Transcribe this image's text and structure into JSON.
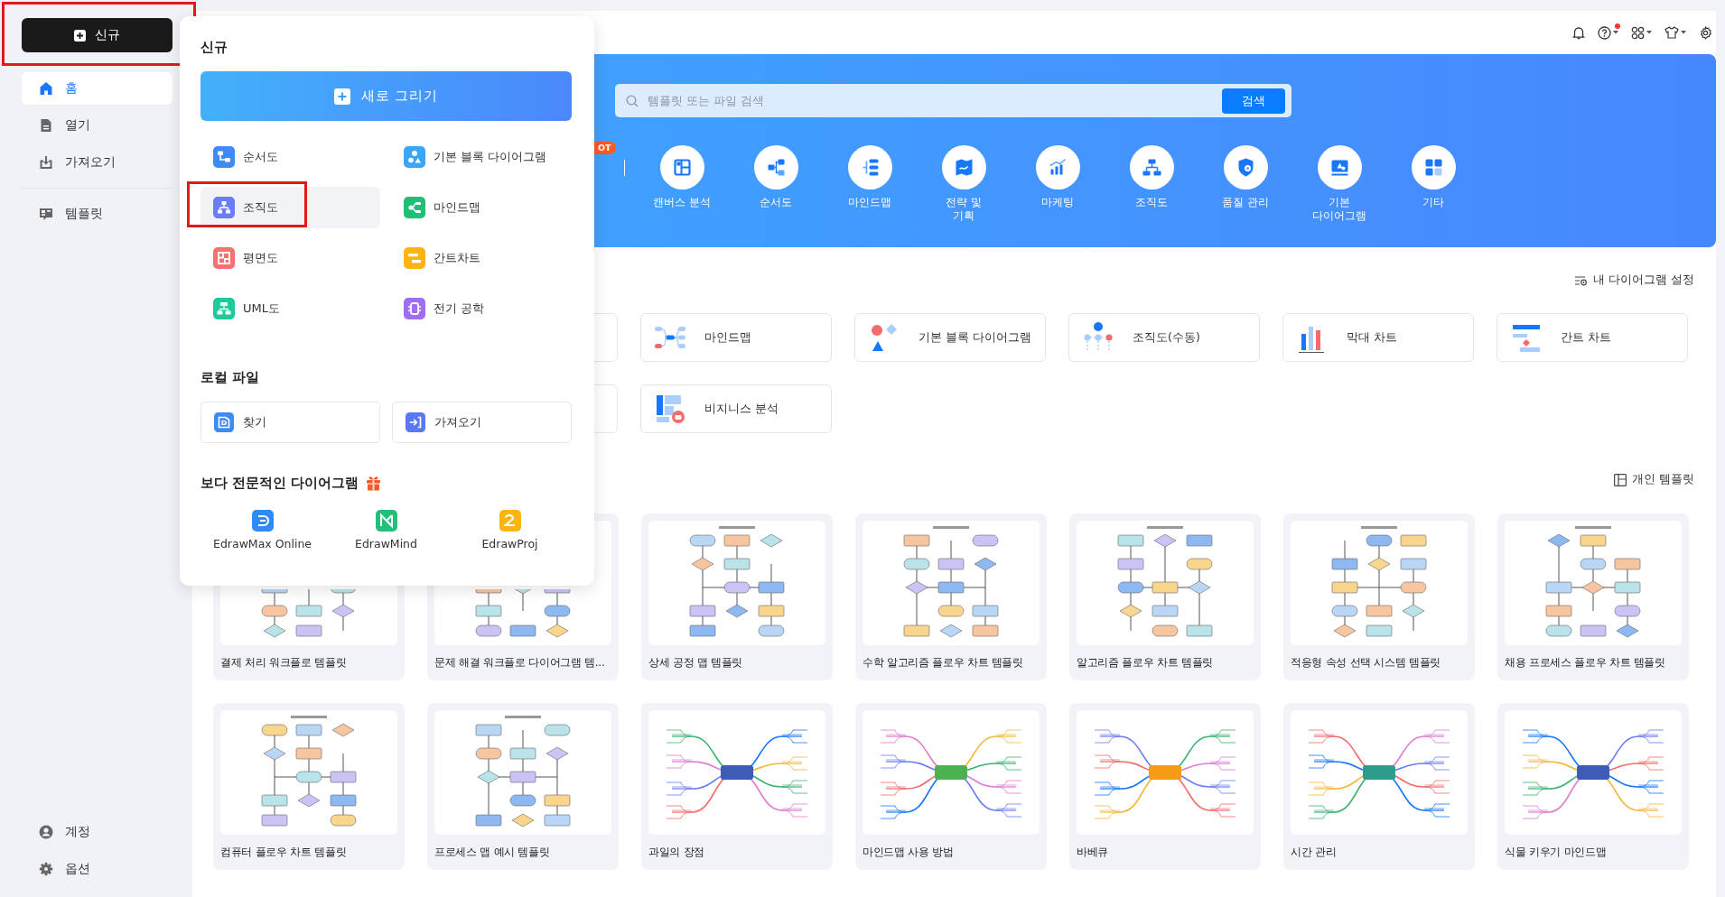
{
  "new_button": {
    "label": "신규",
    "outlined": true
  },
  "sidebar": {
    "main_items": [
      {
        "label": "홈",
        "selected": true
      },
      {
        "label": "열기",
        "selected": false
      },
      {
        "label": "가져오기",
        "selected": false
      }
    ],
    "template_items": [
      {
        "label": "템플릿",
        "selected": false
      }
    ],
    "bottom_items": [
      {
        "label": "계정"
      },
      {
        "label": "옵션"
      }
    ]
  },
  "new_menu": {
    "title": "신규",
    "draw_button": "새로 그리기",
    "diagram_types": [
      {
        "label": "순서도",
        "color": "#3d8bf7",
        "highlighted": false,
        "outlined": false
      },
      {
        "label": "기본 블록 다이어그램",
        "color": "#3aa6f5",
        "highlighted": false,
        "outlined": false
      },
      {
        "label": "조직도",
        "color": "#6a7cf7",
        "highlighted": true,
        "outlined": true
      },
      {
        "label": "마인드맵",
        "color": "#1fbf75",
        "highlighted": false,
        "outlined": false
      },
      {
        "label": "평면도",
        "color": "#f7706e",
        "highlighted": false,
        "outlined": false
      },
      {
        "label": "간트차트",
        "color": "#fbb414",
        "highlighted": false,
        "outlined": false
      },
      {
        "label": "UML도",
        "color": "#1ec99a",
        "highlighted": false,
        "outlined": false
      },
      {
        "label": "전기 공학",
        "color": "#a06ef2",
        "highlighted": false,
        "outlined": false
      }
    ],
    "local_title": "로컬 파일",
    "local_buttons": [
      {
        "label": "찾기",
        "color": "#3d8bf7"
      },
      {
        "label": "가져오기",
        "color": "#5b78f6"
      }
    ],
    "pro_title": "보다 전문적인 다이어그램",
    "apps": [
      {
        "label": "EdrawMax Online",
        "color": "#2d8cf5"
      },
      {
        "label": "EdrawMind",
        "color": "#22c07a"
      },
      {
        "label": "EdrawProj",
        "color": "#fbb414"
      }
    ]
  },
  "top_bar": {
    "help_badge": true
  },
  "banner": {
    "search": {
      "placeholder": "템플릿 또는 파일 검색",
      "button": "검색"
    },
    "hot_badge": "OT",
    "categories": [
      "캔버스 분석",
      "순서도",
      "마인드맵",
      "전략 및\n기획",
      "마케팅",
      "조직도",
      "품질 관리",
      "기본\n다이어그램",
      "기타"
    ]
  },
  "diagram_settings": "내 다이어그램 설정",
  "shortcut_rows": [
    [
      "마인드맵",
      "기본 블록 다이어그램",
      "조직도(수동)",
      "막대 차트",
      "간트 차트"
    ],
    [
      "비지니스 분석"
    ]
  ],
  "personal_templates": "개인 템플릿",
  "templates": [
    {
      "title": "결제 처리 워크플로 템플릿",
      "kind": "flowchart"
    },
    {
      "title": "문제 해결 워크플로 다이어그램 템...",
      "kind": "flowchart"
    },
    {
      "title": "상세 공정 맵 템플릿",
      "kind": "flowchart"
    },
    {
      "title": "수학 알고리즘 플로우 차트 템플릿",
      "kind": "flowchart"
    },
    {
      "title": "알고리즘 플로우 차트 템플릿",
      "kind": "flowchart"
    },
    {
      "title": "적응형 속성 선택 시스템 템플릿",
      "kind": "flowchart"
    },
    {
      "title": "채용 프로세스 플로우 차트 템플릿",
      "kind": "flowchart"
    },
    {
      "title": "컴퓨터 플로우 차트 템플릿",
      "kind": "flowchart"
    },
    {
      "title": "프로세스 맵 예시 템플릿",
      "kind": "flowchart"
    },
    {
      "title": "과일의 장점",
      "kind": "mindmap"
    },
    {
      "title": "마인드맵 사용 방법",
      "kind": "mindmap"
    },
    {
      "title": "바베큐",
      "kind": "mindmap"
    },
    {
      "title": "시간 관리",
      "kind": "mindmap"
    },
    {
      "title": "식물 키우기 마인드맵",
      "kind": "mindmap"
    }
  ]
}
